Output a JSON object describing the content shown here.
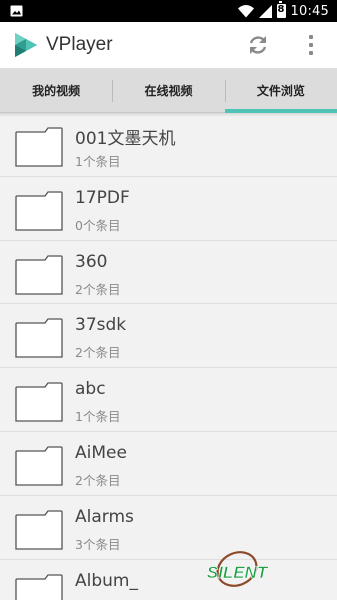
{
  "status_bar": {
    "time": "10:45",
    "battery_label": "8",
    "icons": [
      "picture-icon",
      "wifi-icon",
      "signal-icon",
      "battery-icon"
    ]
  },
  "app": {
    "title": "VPlayer",
    "accent_color": "#4ec3b6"
  },
  "tabs": [
    {
      "label": "我的视频",
      "active": false
    },
    {
      "label": "在线视频",
      "active": false
    },
    {
      "label": "文件浏览",
      "active": true
    }
  ],
  "folders": [
    {
      "name": "001文墨天机",
      "count": "1个条目"
    },
    {
      "name": "17PDF",
      "count": "0个条目"
    },
    {
      "name": "360",
      "count": "2个条目"
    },
    {
      "name": "37sdk",
      "count": "2个条目"
    },
    {
      "name": "abc",
      "count": "1个条目"
    },
    {
      "name": "AiMee",
      "count": "2个条目"
    },
    {
      "name": "Alarms",
      "count": "3个条目"
    },
    {
      "name": "Album_",
      "count": ""
    }
  ],
  "watermark": {
    "text": "SILENT"
  }
}
